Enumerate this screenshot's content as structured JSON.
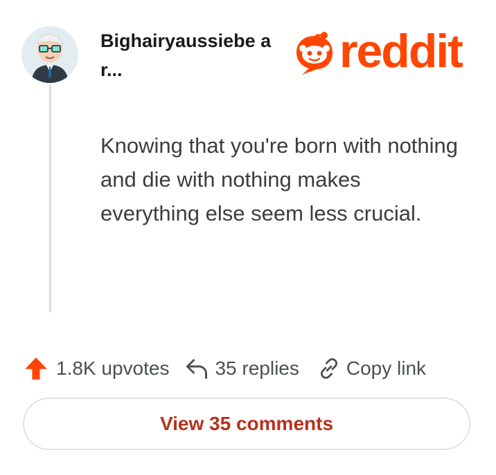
{
  "comment": {
    "username": "Bighairyaussiebe ar...",
    "text": "Knowing that you're born with nothing and die with nothing makes everything else seem less crucial.",
    "avatar_icon": "user-avatar"
  },
  "brand": {
    "name": "reddit",
    "logo_icon": "reddit-snoo-icon",
    "color": "#ff4500"
  },
  "actions": {
    "upvotes_label": "1.8K upvotes",
    "upvote_icon": "upvote-arrow-icon",
    "upvote_color": "#ff4500",
    "replies_label": "35 replies",
    "reply_icon": "reply-arrow-icon",
    "copy_label": "Copy link",
    "copy_icon": "link-icon"
  },
  "view_comments": {
    "label": "View 35 comments",
    "color": "#b8311c"
  }
}
